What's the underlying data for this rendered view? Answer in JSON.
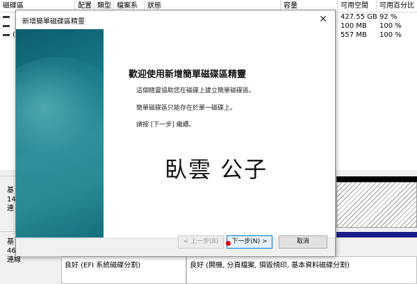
{
  "table": {
    "headers": [
      "磁碟區",
      "配置",
      "類型",
      "檔案系統",
      "狀態",
      "容量",
      "可用空間",
      "可用百分比"
    ],
    "rows": [
      {
        "free": "427.55 GB",
        "pct": "92 %"
      },
      {
        "free": "100 MB",
        "pct": "100 %"
      },
      {
        "free": "557 MB",
        "pct": "100 %"
      }
    ],
    "row3_letter": "("
  },
  "disks": [
    {
      "line1": "基",
      "line2": "14",
      "line3": "連"
    },
    {
      "line1": "基",
      "line2": "46",
      "line3": "連線"
    }
  ],
  "partitions": {
    "efi_status": "良好 (EFI 系統磁碟分割)",
    "main_status": "良好 (開機, 分頁檔案, 損毀傾印, 基本資料磁碟分割)"
  },
  "wizard": {
    "title": "新增簡單磁碟區精靈",
    "close": "✕",
    "heading": "歡迎使用新增簡單磁碟區精靈",
    "para1": "這個精靈協助您在磁碟上建立簡單磁碟區。",
    "para2": "簡單磁碟區只能存在於單一磁碟上。",
    "para3": "請按 [下一步] 繼續。",
    "watermark": "臥雲 公子",
    "back_label": "< 上一步(B)",
    "next_label": "下一步(N) >",
    "cancel_label": "取消"
  }
}
